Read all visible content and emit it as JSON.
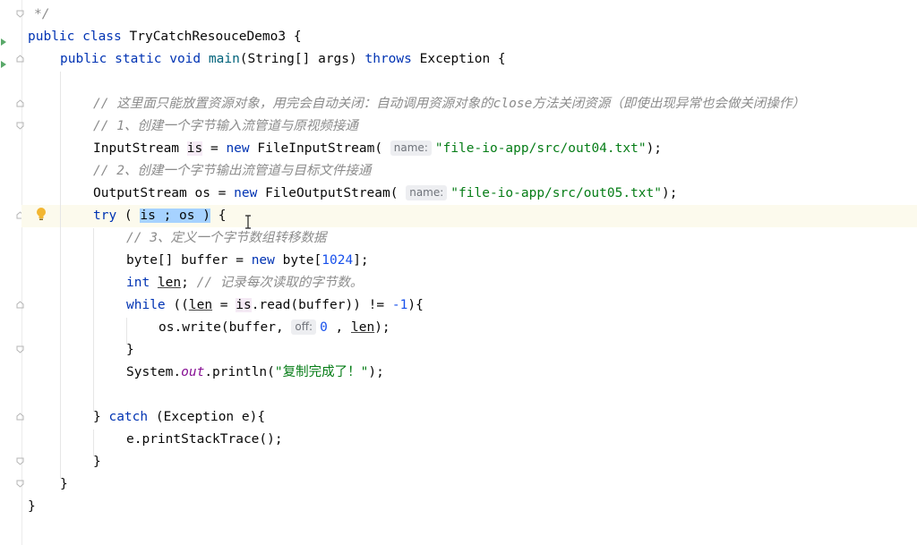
{
  "editor": {
    "lines": {
      "l0": "*/",
      "l1_kw": "public class",
      "l1_name": "TryCatchResouceDemo3",
      "l1_end": " {",
      "l2_kw": "public static void",
      "l2_fn": "main",
      "l2_args": "(String[] args)",
      "l2_throws": "throws",
      "l2_end": "Exception {",
      "l4_comment": "// 这里面只能放置资源对象，用完会自动关闭：自动调用资源对象的close方法关闭资源（即使出现异常也会做关闭操作）",
      "l5_comment": "// 1、创建一个字节输入流管道与原视频接通",
      "l6_type": "InputStream ",
      "l6_var": "is",
      "l6_eq": " = ",
      "l6_new": "new",
      "l6_ctor": " FileInputStream(",
      "l6_hint": "name:",
      "l6_str": "\"file-io-app/src/out04.txt\"",
      "l6_end": ");",
      "l7_comment": "// 2、创建一个字节输出流管道与目标文件接通",
      "l8_type": "OutputStream os = ",
      "l8_new": "new",
      "l8_ctor": " FileOutputStream(",
      "l8_hint": "name:",
      "l8_str": "\"file-io-app/src/out05.txt\"",
      "l8_end": ");",
      "l9_try": "try",
      "l9_open": " ( ",
      "l9_sel": "is ; os )",
      "l9_end": " {",
      "l10_comment": "// 3、定义一个字节数组转移数据",
      "l11_a": "byte[] buffer = ",
      "l11_new": "new",
      "l11_b": " byte[",
      "l11_num": "1024",
      "l11_c": "];",
      "l12_int": "int",
      "l12_len": "len",
      "l12_semi": "; ",
      "l12_comment": "// 记录每次读取的字节数。",
      "l13_while": "while",
      "l13_a": " ((",
      "l13_len": "len",
      "l13_b": " = ",
      "l13_is": "is",
      "l13_c": ".read(buffer)) != ",
      "l13_num": "-1",
      "l13_d": "){",
      "l14_a": "os.write(buffer, ",
      "l14_hint": "off:",
      "l14_num": "0",
      "l14_b": " , ",
      "l14_len": "len",
      "l14_c": ");",
      "l15": "}",
      "l16_a": "System.",
      "l16_out": "out",
      "l16_b": ".println(",
      "l16_str": "\"复制完成了！\"",
      "l16_c": ");",
      "l18_a": "} ",
      "l18_catch": "catch",
      "l18_b": " (Exception e){",
      "l19": "e.printStackTrace();",
      "l20": "}",
      "l21": "}",
      "l22": "}"
    }
  },
  "icons": {
    "bulb": "lightbulb-icon",
    "run": "run-arrow-icon",
    "fold": "fold-marker-icon",
    "caret": "text-cursor-icon"
  },
  "colors": {
    "keyword": "#0033b3",
    "string": "#067d17",
    "number": "#1750eb",
    "comment": "#8c8c8c",
    "selection": "#a6d2ff",
    "current_line": "#fcfaed"
  }
}
